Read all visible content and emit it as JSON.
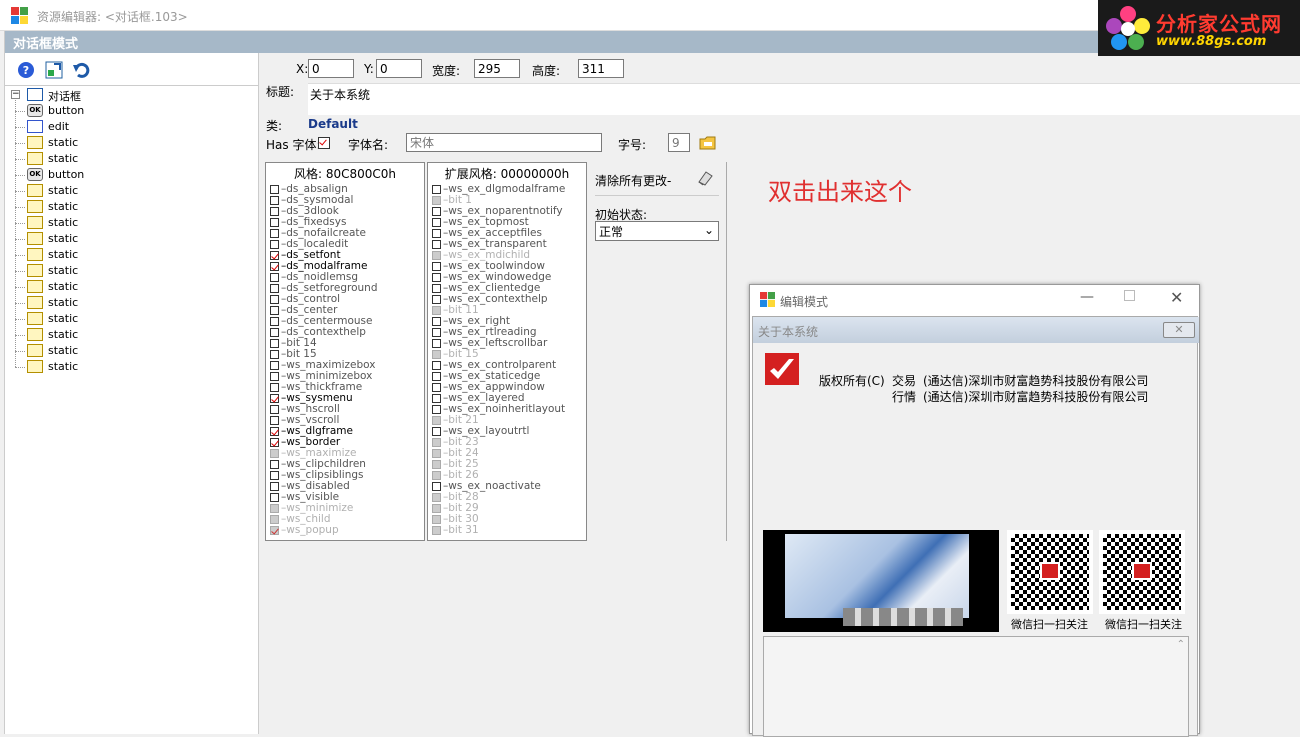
{
  "window": {
    "title": "资源编辑器: <对话框.103>",
    "mode_label": "对话框模式"
  },
  "logo": {
    "line1": "分析家公式网",
    "line2": "www.88gs.com"
  },
  "toolbar": {
    "help_icon": "help-icon",
    "edit_icon": "layout-icon",
    "undo_icon": "undo-icon"
  },
  "tree": {
    "root": "对话框",
    "items": [
      {
        "type": "button",
        "label": "button"
      },
      {
        "type": "edit",
        "label": "edit"
      },
      {
        "type": "static",
        "label": "static"
      },
      {
        "type": "static",
        "label": "static"
      },
      {
        "type": "button",
        "label": "button"
      },
      {
        "type": "static",
        "label": "static"
      },
      {
        "type": "static",
        "label": "static"
      },
      {
        "type": "static",
        "label": "static"
      },
      {
        "type": "static",
        "label": "static"
      },
      {
        "type": "static",
        "label": "static"
      },
      {
        "type": "static",
        "label": "static"
      },
      {
        "type": "static",
        "label": "static"
      },
      {
        "type": "static",
        "label": "static"
      },
      {
        "type": "static",
        "label": "static"
      },
      {
        "type": "static",
        "label": "static"
      },
      {
        "type": "static",
        "label": "static"
      },
      {
        "type": "static",
        "label": "static"
      }
    ],
    "ok_glyph": "OK"
  },
  "props": {
    "x_label": "X:",
    "x_value": "0",
    "y_label": "Y:",
    "y_value": "0",
    "width_label": "宽度:",
    "width_value": "295",
    "height_label": "高度:",
    "height_value": "311",
    "title_label": "标题:",
    "title_value": "关于本系统",
    "class_label": "类:",
    "class_value": "Default",
    "has_font_label": "Has 字体:",
    "font_name_label": "字体名:",
    "font_name_value": "宋体",
    "font_size_label": "字号:",
    "font_size_value": "9"
  },
  "styles": {
    "header": "风格: 80C800C0h",
    "items": [
      {
        "name": "ds_absalign",
        "checked": false,
        "state": "normal"
      },
      {
        "name": "ds_sysmodal",
        "checked": false,
        "state": "normal"
      },
      {
        "name": "ds_3dlook",
        "checked": false,
        "state": "normal"
      },
      {
        "name": "ds_fixedsys",
        "checked": false,
        "state": "normal"
      },
      {
        "name": "ds_nofailcreate",
        "checked": false,
        "state": "normal"
      },
      {
        "name": "ds_localedit",
        "checked": false,
        "state": "normal"
      },
      {
        "name": "ds_setfont",
        "checked": true,
        "state": "bold"
      },
      {
        "name": "ds_modalframe",
        "checked": true,
        "state": "bold"
      },
      {
        "name": "ds_noidlemsg",
        "checked": false,
        "state": "normal"
      },
      {
        "name": "ds_setforeground",
        "checked": false,
        "state": "normal"
      },
      {
        "name": "ds_control",
        "checked": false,
        "state": "normal"
      },
      {
        "name": "ds_center",
        "checked": false,
        "state": "normal"
      },
      {
        "name": "ds_centermouse",
        "checked": false,
        "state": "normal"
      },
      {
        "name": "ds_contexthelp",
        "checked": false,
        "state": "normal"
      },
      {
        "name": "bit 14",
        "checked": false,
        "state": "normal"
      },
      {
        "name": "bit 15",
        "checked": false,
        "state": "normal"
      },
      {
        "name": "ws_maximizebox",
        "checked": false,
        "state": "normal"
      },
      {
        "name": "ws_minimizebox",
        "checked": false,
        "state": "normal"
      },
      {
        "name": "ws_thickframe",
        "checked": false,
        "state": "normal"
      },
      {
        "name": "ws_sysmenu",
        "checked": true,
        "state": "bold"
      },
      {
        "name": "ws_hscroll",
        "checked": false,
        "state": "normal"
      },
      {
        "name": "ws_vscroll",
        "checked": false,
        "state": "normal"
      },
      {
        "name": "ws_dlgframe",
        "checked": true,
        "state": "bold"
      },
      {
        "name": "ws_border",
        "checked": true,
        "state": "bold"
      },
      {
        "name": "ws_maximize",
        "checked": false,
        "state": "disabled"
      },
      {
        "name": "ws_clipchildren",
        "checked": false,
        "state": "normal"
      },
      {
        "name": "ws_clipsiblings",
        "checked": false,
        "state": "normal"
      },
      {
        "name": "ws_disabled",
        "checked": false,
        "state": "normal"
      },
      {
        "name": "ws_visible",
        "checked": false,
        "state": "normal"
      },
      {
        "name": "ws_minimize",
        "checked": false,
        "state": "disabled"
      },
      {
        "name": "ws_child",
        "checked": false,
        "state": "disabled"
      },
      {
        "name": "ws_popup",
        "checked": true,
        "state": "disabled"
      }
    ]
  },
  "ex_styles": {
    "header": "扩展风格: 00000000h",
    "items": [
      {
        "name": "ws_ex_dlgmodalframe",
        "checked": false,
        "state": "normal"
      },
      {
        "name": "bit 1",
        "checked": false,
        "state": "disabled"
      },
      {
        "name": "ws_ex_noparentnotify",
        "checked": false,
        "state": "normal"
      },
      {
        "name": "ws_ex_topmost",
        "checked": false,
        "state": "normal"
      },
      {
        "name": "ws_ex_acceptfiles",
        "checked": false,
        "state": "normal"
      },
      {
        "name": "ws_ex_transparent",
        "checked": false,
        "state": "normal"
      },
      {
        "name": "ws_ex_mdichild",
        "checked": false,
        "state": "disabled"
      },
      {
        "name": "ws_ex_toolwindow",
        "checked": false,
        "state": "normal"
      },
      {
        "name": "ws_ex_windowedge",
        "checked": false,
        "state": "normal"
      },
      {
        "name": "ws_ex_clientedge",
        "checked": false,
        "state": "normal"
      },
      {
        "name": "ws_ex_contexthelp",
        "checked": false,
        "state": "normal"
      },
      {
        "name": "bit 11",
        "checked": false,
        "state": "disabled"
      },
      {
        "name": "ws_ex_right",
        "checked": false,
        "state": "normal"
      },
      {
        "name": "ws_ex_rtlreading",
        "checked": false,
        "state": "normal"
      },
      {
        "name": "ws_ex_leftscrollbar",
        "checked": false,
        "state": "normal"
      },
      {
        "name": "bit 15",
        "checked": false,
        "state": "disabled"
      },
      {
        "name": "ws_ex_controlparent",
        "checked": false,
        "state": "normal"
      },
      {
        "name": "ws_ex_staticedge",
        "checked": false,
        "state": "normal"
      },
      {
        "name": "ws_ex_appwindow",
        "checked": false,
        "state": "normal"
      },
      {
        "name": "ws_ex_layered",
        "checked": false,
        "state": "normal"
      },
      {
        "name": "ws_ex_noinheritlayout",
        "checked": false,
        "state": "normal"
      },
      {
        "name": "bit 21",
        "checked": false,
        "state": "disabled"
      },
      {
        "name": "ws_ex_layoutrtl",
        "checked": false,
        "state": "normal"
      },
      {
        "name": "bit 23",
        "checked": false,
        "state": "disabled"
      },
      {
        "name": "bit 24",
        "checked": false,
        "state": "disabled"
      },
      {
        "name": "bit 25",
        "checked": false,
        "state": "disabled"
      },
      {
        "name": "bit 26",
        "checked": false,
        "state": "disabled"
      },
      {
        "name": "ws_ex_noactivate",
        "checked": false,
        "state": "normal"
      },
      {
        "name": "bit 28",
        "checked": false,
        "state": "disabled"
      },
      {
        "name": "bit 29",
        "checked": false,
        "state": "disabled"
      },
      {
        "name": "bit 30",
        "checked": false,
        "state": "disabled"
      },
      {
        "name": "bit 31",
        "checked": false,
        "state": "disabled"
      }
    ]
  },
  "options": {
    "clear_changes": "清除所有更改-",
    "initial_state_label": "初始状态:",
    "initial_state_value": "正常"
  },
  "annotation": "双击出来这个",
  "preview": {
    "window_title": "编辑模式",
    "dialog_title": "关于本系统",
    "close_glyph": "✕",
    "copyright_label": "版权所有(C)",
    "row1_prefix": "交易",
    "row1_text": "(通达信)深圳市财富趋势科技股份有限公司",
    "row2_prefix": "行情",
    "row2_text": "(通达信)深圳市财富趋势科技股份有限公司",
    "qr1_caption": "微信扫一扫关注",
    "qr2_caption": "微信扫一扫关注"
  }
}
